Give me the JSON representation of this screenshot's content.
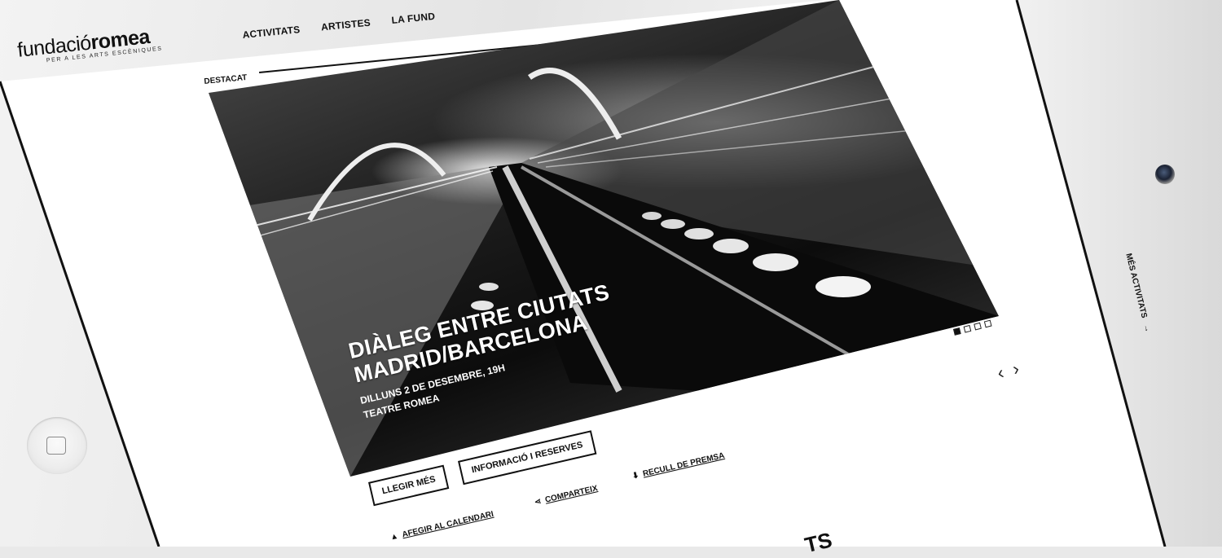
{
  "logo": {
    "main_light": "fundació",
    "main_bold": "romea",
    "tagline": "PER A LES ARTS ESCÈNIQUES"
  },
  "nav": {
    "items": [
      {
        "label": "ACTIVITATS"
      },
      {
        "label": "ARTISTES"
      },
      {
        "label": "LA FUND"
      }
    ]
  },
  "featured": {
    "section_label": "DESTACAT",
    "title_line1": "DIÀLEG ENTRE CIUTATS",
    "title_line2": "MADRID/BARCELONA",
    "date": "DILLUNS 2 DE DESEMBRE, 19H",
    "venue": "TEATRE ROMEA",
    "slides_total": 4,
    "slide_active": 1,
    "prev_arrow": "‹",
    "next_arrow": "›"
  },
  "actions": {
    "read_more": "LLEGIR MÉS",
    "info_booking": "INFORMACIÓ I RESERVES",
    "press": "RECULL DE PREMSA",
    "share": "COMPARTEIX",
    "add_calendar": "AFEGIR AL CALENDARI"
  },
  "side": {
    "more_activities": "MÉS ACTIVITATS"
  },
  "bottom_fragment": "TS",
  "icons": {
    "press": "download-icon",
    "share": "share-icon",
    "calendar": "bell-icon"
  }
}
